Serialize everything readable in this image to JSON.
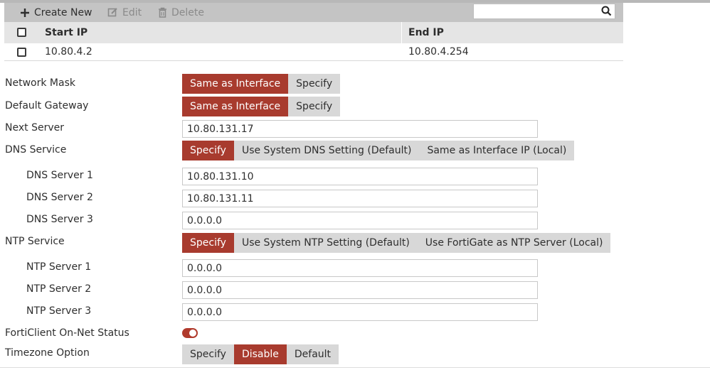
{
  "toolbar": {
    "create_label": "Create New",
    "edit_label": "Edit",
    "delete_label": "Delete",
    "search_value": ""
  },
  "table": {
    "columns": [
      "Start IP",
      "End IP"
    ],
    "rows": [
      {
        "start_ip": "10.80.4.2",
        "end_ip": "10.80.4.254"
      }
    ]
  },
  "form": {
    "network_mask": {
      "label": "Network Mask",
      "options": [
        "Same as Interface",
        "Specify"
      ],
      "selected": "Same as Interface"
    },
    "default_gateway": {
      "label": "Default Gateway",
      "options": [
        "Same as Interface",
        "Specify"
      ],
      "selected": "Same as Interface"
    },
    "next_server": {
      "label": "Next Server",
      "value": "10.80.131.17"
    },
    "dns_service": {
      "label": "DNS Service",
      "options": [
        "Specify",
        "Use System DNS Setting (Default)",
        "Same as Interface IP (Local)"
      ],
      "selected": "Specify"
    },
    "dns_servers": [
      {
        "label": "DNS Server 1",
        "value": "10.80.131.10"
      },
      {
        "label": "DNS Server 2",
        "value": "10.80.131.11"
      },
      {
        "label": "DNS Server 3",
        "value": "0.0.0.0"
      }
    ],
    "ntp_service": {
      "label": "NTP Service",
      "options": [
        "Specify",
        "Use System NTP Setting (Default)",
        "Use FortiGate as NTP Server (Local)"
      ],
      "selected": "Specify"
    },
    "ntp_servers": [
      {
        "label": "NTP Server 1",
        "value": "0.0.0.0"
      },
      {
        "label": "NTP Server 2",
        "value": "0.0.0.0"
      },
      {
        "label": "NTP Server 3",
        "value": "0.0.0.0"
      }
    ],
    "forticlient_status": {
      "label": "FortiClient On-Net Status",
      "enabled": true
    },
    "timezone_option": {
      "label": "Timezone Option",
      "options": [
        "Specify",
        "Disable",
        "Default"
      ],
      "selected": "Disable"
    }
  },
  "colors": {
    "accent": "#a83b2e",
    "segment_bg": "#d8d8d8",
    "toolbar_bg": "#c4c4c4"
  }
}
